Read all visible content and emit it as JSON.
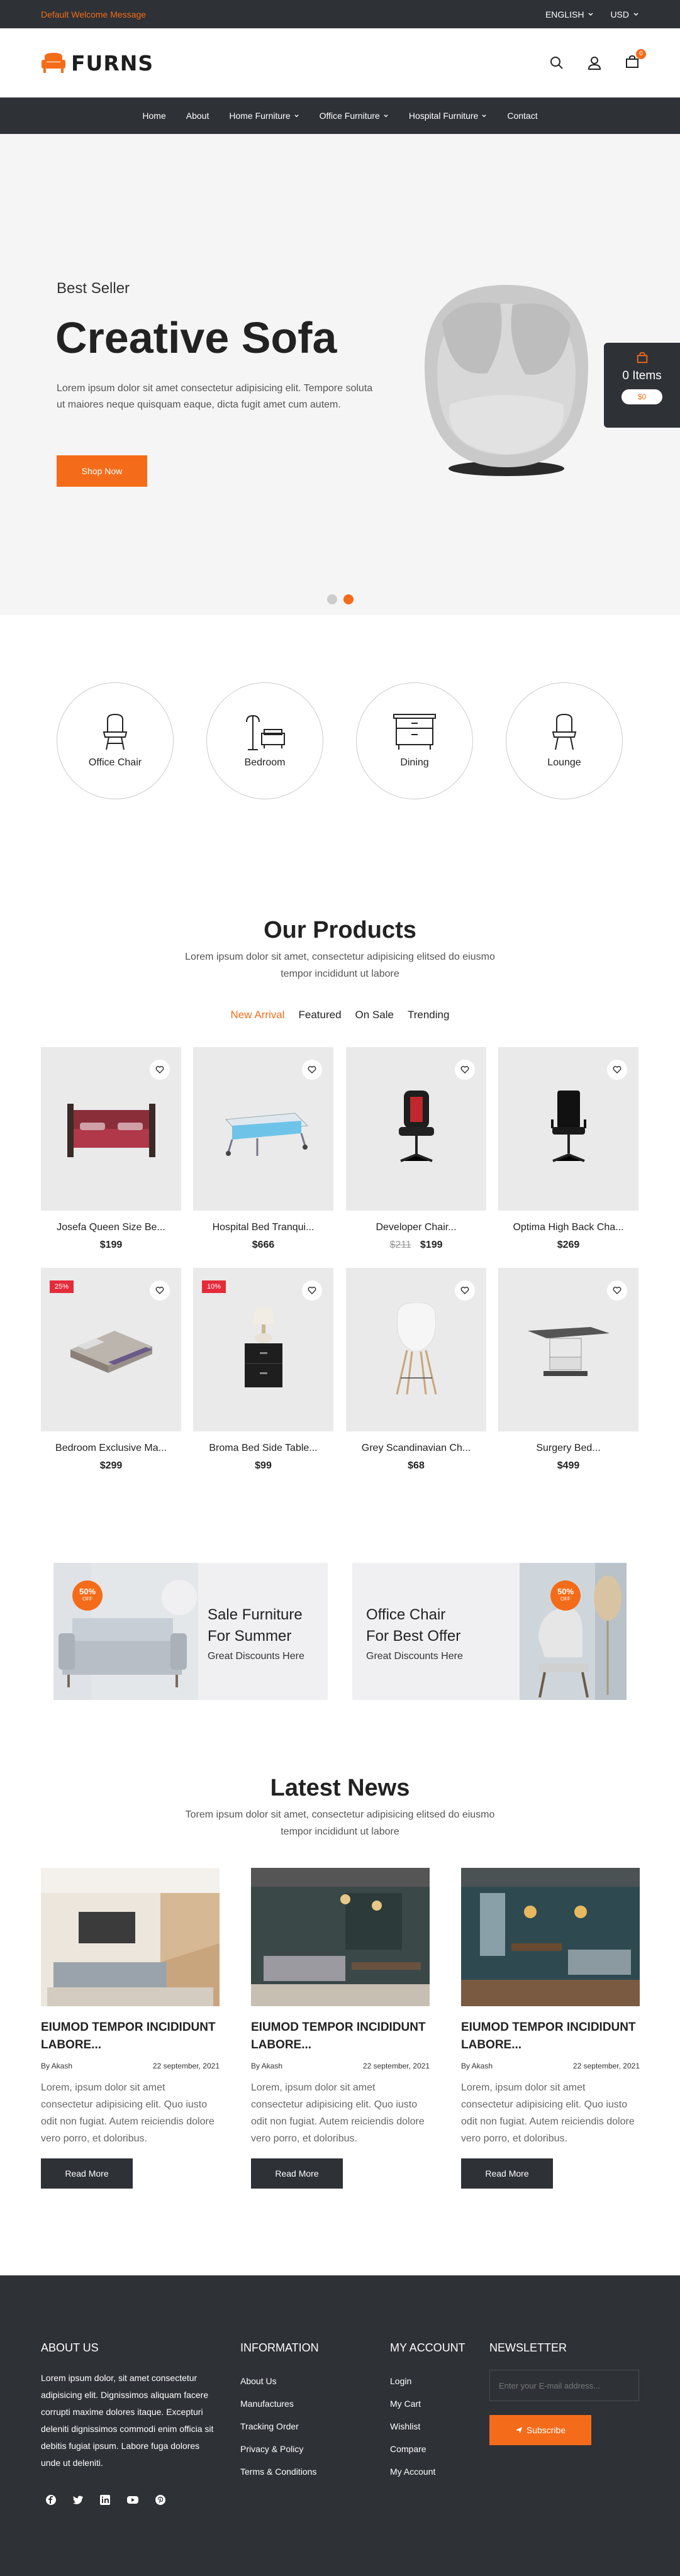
{
  "topbar": {
    "welcome": "Default Welcome Message",
    "language": "ENGLISH",
    "currency": "USD"
  },
  "header": {
    "logo": "FURNS",
    "cart_count": "0"
  },
  "nav": {
    "items": [
      "Home",
      "About",
      "Home Furniture",
      "Office Furniture",
      "Hospital Furniture",
      "Contact"
    ]
  },
  "hero": {
    "subtitle": "Best Seller",
    "title": "Creative Sofa",
    "text": "Lorem ipsum dolor sit amet consectetur adipisicing elit. Tempore soluta ut maiores neque quisquam eaque, dicta fugit amet cum autem.",
    "button": "Shop Now",
    "cart_items": "0 Items",
    "cart_price": "$0"
  },
  "categories": [
    "Office Chair",
    "Bedroom",
    "Dining",
    "Lounge"
  ],
  "products_section": {
    "title": "Our Products",
    "desc": "Lorem ipsum dolor sit amet, consectetur adipisicing elitsed do eiusmo tempor incididunt ut labore",
    "tabs": [
      "New Arrival",
      "Featured",
      "On Sale",
      "Trending"
    ]
  },
  "products": [
    {
      "name": "Josefa Queen Size Be...",
      "price": "$199"
    },
    {
      "name": "Hospital Bed Tranqui...",
      "price": "$666"
    },
    {
      "name": "Developer Chair...",
      "old_price": "$211",
      "price": "$199"
    },
    {
      "name": "Optima High Back Cha...",
      "price": "$269"
    },
    {
      "name": "Bedroom Exclusive Ma...",
      "price": "$299",
      "badge": "25%"
    },
    {
      "name": "Broma Bed Side Table...",
      "price": "$99",
      "badge": "10%"
    },
    {
      "name": "Grey Scandinavian Ch...",
      "price": "$68"
    },
    {
      "name": "Surgery Bed...",
      "price": "$499"
    }
  ],
  "banners": [
    {
      "title1": "Sale Furniture",
      "title2": "For Summer",
      "desc": "Great Discounts Here",
      "pct": "50%",
      "pct_label": "OFF"
    },
    {
      "title1": "Office Chair",
      "title2": "For Best Offer",
      "desc": "Great Discounts Here",
      "pct": "50%",
      "pct_label": "OFF"
    }
  ],
  "news_section": {
    "title": "Latest News",
    "desc": "Torem ipsum dolor sit amet, consectetur adipisicing elitsed do eiusmo tempor incididunt ut labore"
  },
  "news": [
    {
      "title": "EIUMOD TEMPOR INCIDIDUNT LABORE...",
      "author": "By Akash",
      "date": "22 september, 2021",
      "text": "Lorem, ipsum dolor sit amet consectetur adipisicing elit. Quo iusto odit non fugiat. Autem reiciendis dolore vero porro, et doloribus.",
      "button": "Read More"
    },
    {
      "title": "EIUMOD TEMPOR INCIDIDUNT LABORE...",
      "author": "By Akash",
      "date": "22 september, 2021",
      "text": "Lorem, ipsum dolor sit amet consectetur adipisicing elit. Quo iusto odit non fugiat. Autem reiciendis dolore vero porro, et doloribus.",
      "button": "Read More"
    },
    {
      "title": "EIUMOD TEMPOR INCIDIDUNT LABORE...",
      "author": "By Akash",
      "date": "22 september, 2021",
      "text": "Lorem, ipsum dolor sit amet consectetur adipisicing elit. Quo iusto odit non fugiat. Autem reiciendis dolore vero porro, et doloribus.",
      "button": "Read More"
    }
  ],
  "footer": {
    "about_title": "ABOUT US",
    "about_text": "Lorem ipsum dolor, sit amet consectetur adipisicing elit. Dignissimos aliquam facere corrupti maxime dolores itaque. Excepturi deleniti dignissimos commodi enim officia sit debitis fugiat ipsum. Labore fuga dolores unde ut deleniti.",
    "info_title": "INFORMATION",
    "info_links": [
      "About Us",
      "Manufactures",
      "Tracking Order",
      "Privacy & Policy",
      "Terms & Conditions"
    ],
    "account_title": "MY ACCOUNT",
    "account_links": [
      "Login",
      "My Cart",
      "Wishlist",
      "Compare",
      "My Account"
    ],
    "newsletter_title": "NEWSLETTER",
    "email_placeholder": "Enter your E-mail address...",
    "subscribe": "Subscribe"
  },
  "colors": {
    "accent": "#f46c1a",
    "dark": "#2e3136",
    "sale": "#e52b3a"
  }
}
